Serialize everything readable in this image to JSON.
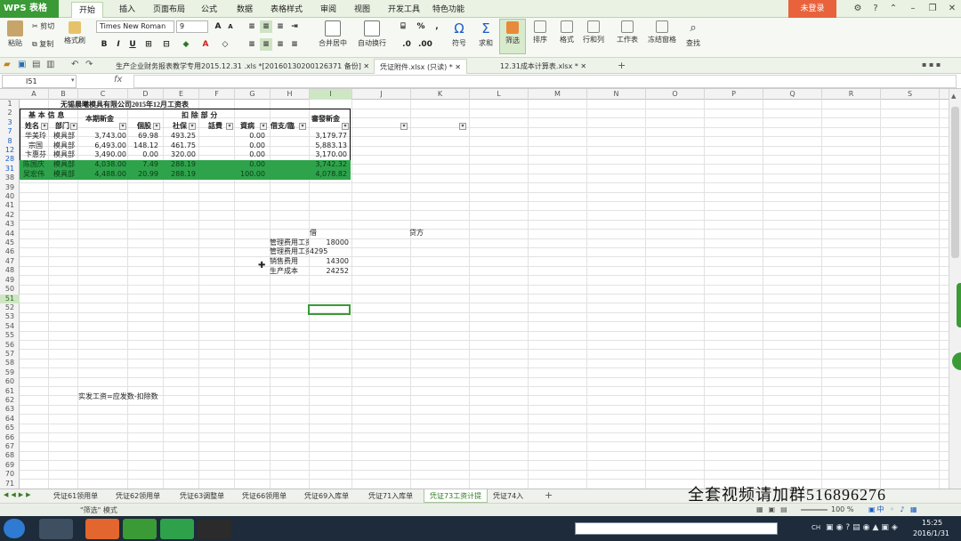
{
  "app": {
    "logo": "WPS 表格",
    "menus": [
      "开始",
      "插入",
      "页面布局",
      "公式",
      "数据",
      "表格样式",
      "审阅",
      "视图",
      "开发工具",
      "特色功能"
    ],
    "login": "未登录"
  },
  "ribbon": {
    "paste": "粘贴",
    "cut": "剪切",
    "copy": "复制",
    "format_painter": "格式刷",
    "font_name": "Times New Roman",
    "font_size": "9",
    "merge_center": "合并居中",
    "wrap_text": "自动换行",
    "symbol": "符号",
    "sum": "求和",
    "filter": "筛选",
    "sort": "排序",
    "format": "格式",
    "rows_cols": "行和列",
    "worksheet": "工作表",
    "freeze": "冻结窗格",
    "find": "查找"
  },
  "doc_tabs": [
    "生产企业财务报表教学专用2015.12.31 .xls *[20160130200126371 备份]",
    "凭证附件.xlsx (只读) *",
    "12.31成本计算表.xlsx *"
  ],
  "formula_bar": {
    "name_box": "I51",
    "fx": "fx",
    "value": ""
  },
  "columns": [
    "A",
    "B",
    "C",
    "D",
    "E",
    "F",
    "G",
    "H",
    "I",
    "J",
    "K",
    "L",
    "M",
    "N",
    "O",
    "P",
    "Q",
    "R",
    "S"
  ],
  "rows": [
    "1",
    "2",
    "3",
    "7",
    "8",
    "12",
    "28",
    "31",
    "38",
    "39",
    "40",
    "41",
    "42",
    "43",
    "44",
    "45",
    "46",
    "47",
    "48",
    "49",
    "50",
    "51",
    "52",
    "53",
    "54",
    "55",
    "56",
    "57",
    "58",
    "59",
    "60",
    "61",
    "62",
    "63",
    "64",
    "65",
    "66",
    "67",
    "68",
    "69",
    "70",
    "71"
  ],
  "sheet": {
    "title": "无锡晨曦模具有限公司2015年12月工资表",
    "header_basic": "基 本 信 息",
    "header_name": "姓名",
    "header_dept": "部门",
    "header_pay": "本期新金",
    "header_deduct": "扣    除    部    分",
    "header_tax": "個股",
    "header_social": "社保",
    "header_phone": "話費",
    "header_fund": "資病",
    "header_other": "借支/臨",
    "header_net": "審發新金",
    "table_rows": [
      {
        "name": "华美玲",
        "dept": "模具部",
        "pay": "3,743.00",
        "tax": "69.98",
        "social": "493.25",
        "fund": "0.00",
        "net": "3,179.77"
      },
      {
        "name": "宗国",
        "dept": "模具部",
        "pay": "6,493.00",
        "tax": "148.12",
        "social": "461.75",
        "fund": "0.00",
        "net": "5,883.13"
      },
      {
        "name": "卞惠芬",
        "dept": "模具部",
        "pay": "3,490.00",
        "tax": "0.00",
        "social": "320.00",
        "fund": "0.00",
        "net": "3,170.00"
      },
      {
        "name": "陈国庆",
        "dept": "模具部",
        "pay": "4,038.00",
        "tax": "7.49",
        "social": "288.19",
        "fund": "0.00",
        "net": "3,742.32"
      },
      {
        "name": "吴宏伟",
        "dept": "模具部",
        "pay": "4,488.00",
        "tax": "20.99",
        "social": "288.19",
        "fund": "100.00",
        "net": "4,078.82"
      }
    ],
    "debit_label": "借",
    "credit_label": "贷方",
    "entries": [
      {
        "label": "管理费用工资",
        "value": "18000"
      },
      {
        "label": "管理费用工资",
        "value": "4295"
      },
      {
        "label": "销售费用",
        "value": "14300"
      },
      {
        "label": "生产成本",
        "value": "24252"
      }
    ],
    "note": "实发工资=应发数-扣除数"
  },
  "sheet_tabs": [
    "凭证61领用单",
    "凭证62领用单",
    "凭证63调整单",
    "凭证66领用单",
    "凭证69入库单",
    "凭证71入库单",
    "凭证73工资计提",
    "凭证74入"
  ],
  "active_sheet": "凭证73工资计提",
  "status": {
    "mode": "\"筛选\" 模式",
    "zoom": "100 %"
  },
  "taskbar": {
    "time": "15:25",
    "date": "2016/1/31",
    "lang": "CH"
  },
  "watermark": "全套视频请加群516896276",
  "colors": {
    "accent": "#3a9a35",
    "highlight": "#2ea34b",
    "login": "#e8623c"
  }
}
